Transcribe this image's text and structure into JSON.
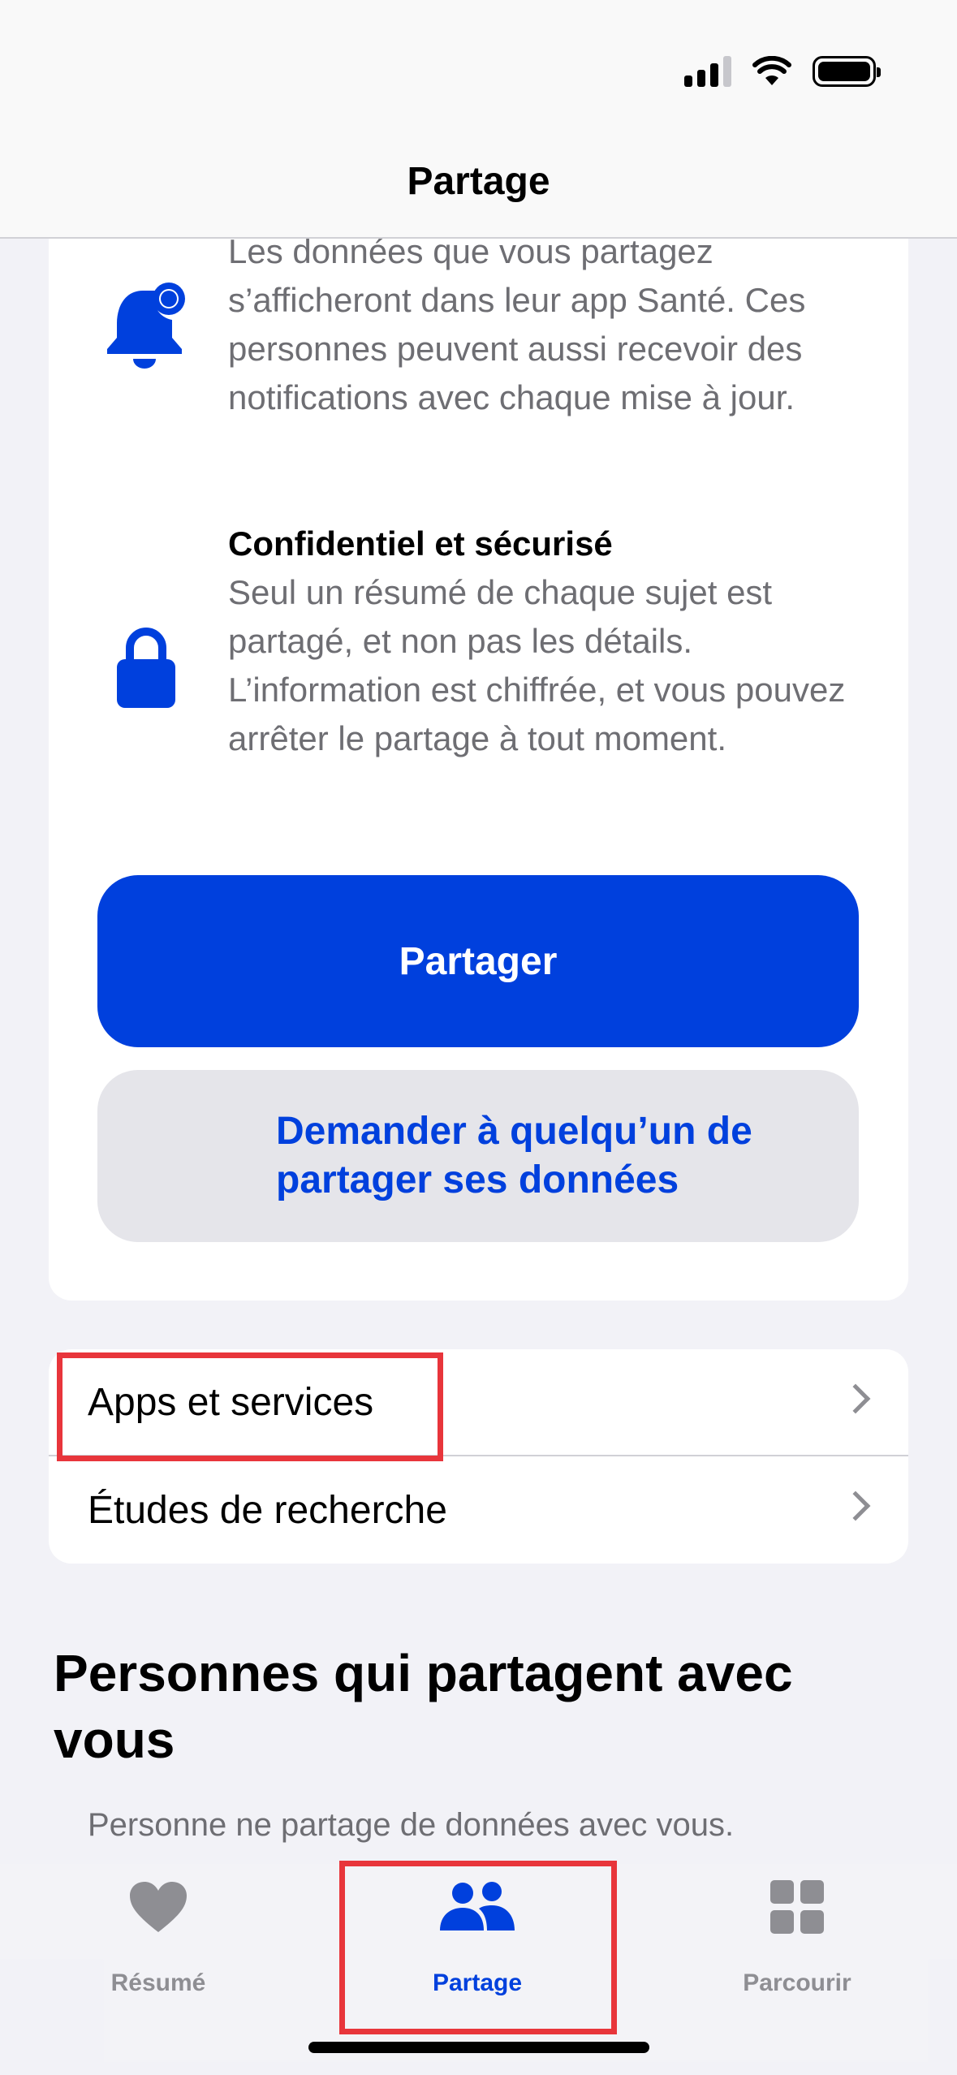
{
  "nav": {
    "title": "Partage"
  },
  "features": [
    {
      "title": "",
      "text": "Les données que vous partagez s’afficheront dans leur app Santé. Ces personnes peuvent aussi recevoir des notifications avec chaque mise à jour.",
      "icon": "bell-badge-icon"
    },
    {
      "title": "Confidentiel et sécurisé",
      "text": "Seul un résumé de chaque sujet est partagé, et non pas les détails. L’information est chiffrée, et vous pouvez arrêter le partage à tout moment.",
      "icon": "lock-icon"
    }
  ],
  "buttons": {
    "share": "Partager",
    "request": "Demander à quelqu’un de partager ses données"
  },
  "list": [
    {
      "label": "Apps et services"
    },
    {
      "label": "Études de recherche"
    }
  ],
  "people_section": {
    "title": "Personnes qui partagent avec vous",
    "empty": "Personne ne partage de données avec vous."
  },
  "tabs": [
    {
      "label": "Résumé",
      "icon": "heart-icon",
      "active": false
    },
    {
      "label": "Partage",
      "icon": "people-icon",
      "active": true
    },
    {
      "label": "Parcourir",
      "icon": "grid-icon",
      "active": false
    }
  ],
  "colors": {
    "accent": "#0040dd",
    "background": "#f2f2f7",
    "secondary_button": "#e5e5ea",
    "highlight": "#e8353b"
  }
}
